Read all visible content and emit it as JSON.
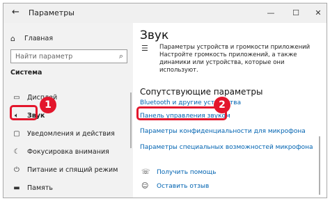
{
  "window": {
    "title": "Параметры",
    "back_icon": "back-arrow-icon",
    "controls": [
      "minimize",
      "maximize",
      "close"
    ]
  },
  "sidebar": {
    "home_label": "Главная",
    "search_placeholder": "Найти параметр",
    "section_title": "Система",
    "items": [
      {
        "label": "Дисплей",
        "icon": "display-icon"
      },
      {
        "label": "Звук",
        "icon": "speaker-icon",
        "active": true
      },
      {
        "label": "Уведомления и действия",
        "icon": "notifications-icon"
      },
      {
        "label": "Фокусировка внимания",
        "icon": "focus-assist-icon"
      },
      {
        "label": "Питание и спящий режим",
        "icon": "power-icon"
      },
      {
        "label": "Память",
        "icon": "storage-icon"
      }
    ]
  },
  "content": {
    "title": "Звук",
    "previous_setting": "Параметры устройств и громкости приложений\nНастройте громкость приложений, а также динамики или устройства, которые они используют.",
    "related_title": "Сопутствующие параметры",
    "related_links": [
      "Bluetooth и другие устройства",
      "Панель управления звуком",
      "Параметры конфиденциальности для микрофона",
      "Параметры специальных возможностей микрофона"
    ],
    "help_links": [
      {
        "label": "Получить помощь",
        "icon": "help-icon"
      },
      {
        "label": "Оставить отзыв",
        "icon": "feedback-icon"
      }
    ]
  },
  "annotations": {
    "badge_1": "1",
    "badge_2": "2",
    "color": "#e3162c"
  }
}
